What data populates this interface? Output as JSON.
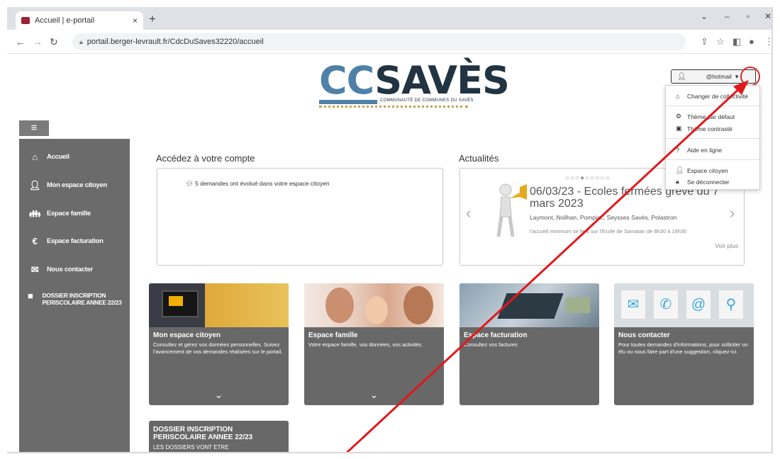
{
  "browser": {
    "tab_title": "Accueil | e-portail",
    "tab_close": "×",
    "new_tab": "+",
    "url": "portail.berger-levrault.fr/CdcDuSaves32220/accueil"
  },
  "logo": {
    "cc": "CC",
    "saves": "SAVÈS",
    "subtitle": "COMMUNAUTÉ DE COMMUNES DU SAVÈS"
  },
  "sidebar": {
    "menu_icon": "≡",
    "items": [
      {
        "label": "Accueil",
        "icon": "home-icon"
      },
      {
        "label": "Mon espace citoyen",
        "icon": "user-icon"
      },
      {
        "label": "Espace famille",
        "icon": "family-icon"
      },
      {
        "label": "Espace facturation",
        "icon": "euro-icon"
      },
      {
        "label": "Nous contacter",
        "icon": "mail-icon"
      },
      {
        "label": "DOSSIER INSCRIPTION PERISCOLAIRE ANNEE 22/23",
        "icon": "document-icon"
      }
    ]
  },
  "account": {
    "title": "Accédez à votre compte",
    "notification": "5 demandes ont évolué dans votre espace citoyen"
  },
  "news": {
    "title": "Actualités",
    "headline": "06/03/23 - Ecoles fermées grève du 7 mars 2023",
    "locations": "Laymont, Noilhan, Pompiac, Seysses Savès, Polastron",
    "excerpt": "l'accueil minimum se fera sur l'Ecole de Samatan de 8h30 à 16h30",
    "more": "Voir plus",
    "dots": "○○○●○○○○○",
    "active_slide": 4,
    "slide_count": 9
  },
  "cards": [
    {
      "title": "Mon espace citoyen",
      "desc": "Consultez et gérez vos données personnelles. Suivez l'avancement de vos demandes réalisées sur le portail.",
      "chevron": "⌄"
    },
    {
      "title": "Espace famille",
      "desc": "Votre espace famille, vos données, vos activités.",
      "chevron": "⌄"
    },
    {
      "title": "Espace facturation",
      "desc": "Consultez vos factures",
      "chevron": ""
    },
    {
      "title": "Nous contacter",
      "desc": "Pour toutes demandes d'informations, pour solliciter un élu ou nous faire part d'une suggestion, cliquez-ici.",
      "chevron": ""
    }
  ],
  "dossier_card": {
    "title": "DOSSIER INSCRIPTION PERISCOLAIRE ANNEE 22/23",
    "desc": "LES DOSSIERS VONT ETRE"
  },
  "user_menu": {
    "email": "@hotmail",
    "items": [
      {
        "label": "Changer de collectivité",
        "icon": "home-icon"
      },
      {
        "label": "Thème par défaut",
        "icon": "settings-icon"
      },
      {
        "label": "Thème contrasté",
        "icon": "contrast-icon"
      },
      {
        "label": "Aide en ligne",
        "icon": "help-icon"
      },
      {
        "label": "Espace citoyen",
        "icon": "user-icon"
      },
      {
        "label": "Se déconnecter",
        "icon": "lock-icon"
      }
    ]
  },
  "colors": {
    "sidebar": "#6b6b6b",
    "card": "#686868",
    "annotation": "#e0191b",
    "logo_cc": "#4f81a8",
    "logo_saves": "#223342"
  }
}
